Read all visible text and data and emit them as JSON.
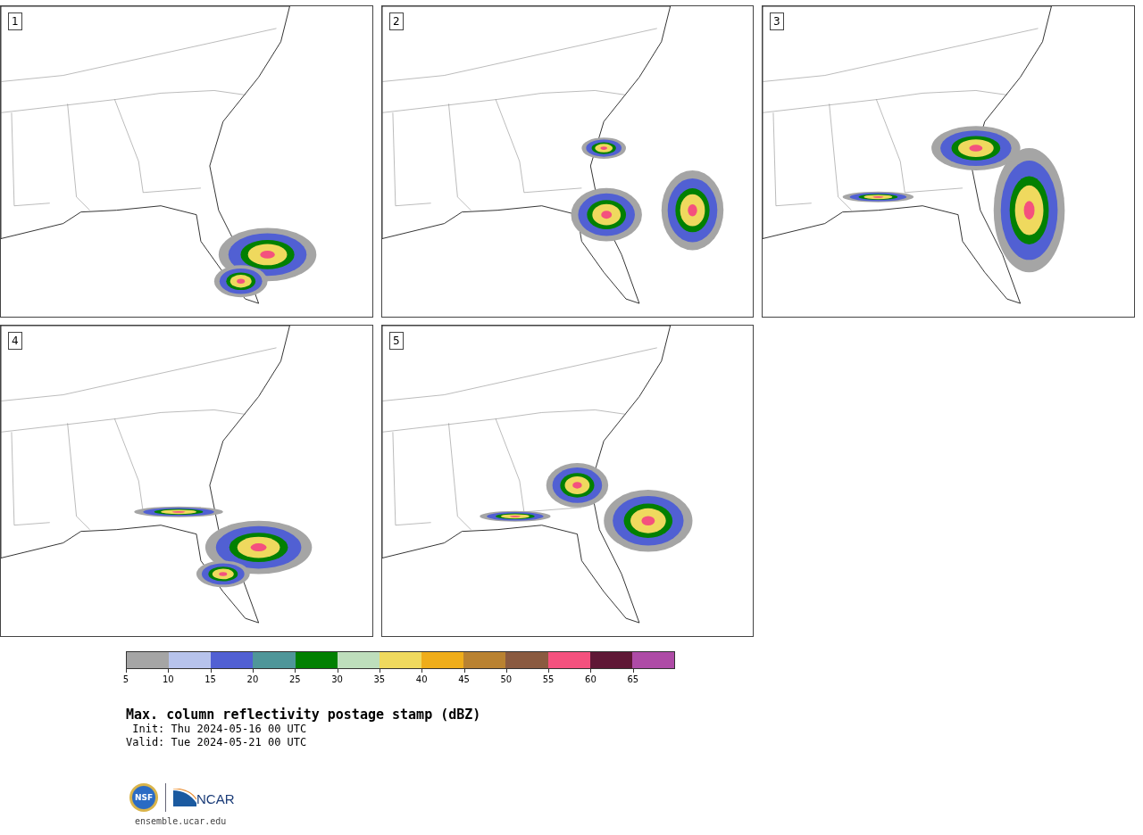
{
  "panels": [
    {
      "label": "1"
    },
    {
      "label": "2"
    },
    {
      "label": "3"
    },
    {
      "label": "4"
    },
    {
      "label": "5"
    }
  ],
  "colorbar": {
    "segments": [
      {
        "color": "#a5a5a5"
      },
      {
        "color": "#b7c3ec"
      },
      {
        "color": "#5160d3"
      },
      {
        "color": "#4f9699"
      },
      {
        "color": "#028002"
      },
      {
        "color": "#bedebc"
      },
      {
        "color": "#efd95e"
      },
      {
        "color": "#efad1a"
      },
      {
        "color": "#b98231"
      },
      {
        "color": "#8a5a40"
      },
      {
        "color": "#f4517e"
      },
      {
        "color": "#5f1836"
      },
      {
        "color": "#ae4ba6"
      }
    ],
    "ticks": [
      "5",
      "10",
      "15",
      "20",
      "25",
      "30",
      "35",
      "40",
      "45",
      "50",
      "55",
      "60",
      "65"
    ]
  },
  "title": "Max. column reflectivity postage stamp (dBZ)",
  "init": " Init: Thu 2024-05-16 00 UTC",
  "valid": "Valid: Tue 2024-05-21 00 UTC",
  "logos": {
    "nsf": "NSF",
    "ncar": "NCAR"
  },
  "url": "ensemble.ucar.edu"
}
